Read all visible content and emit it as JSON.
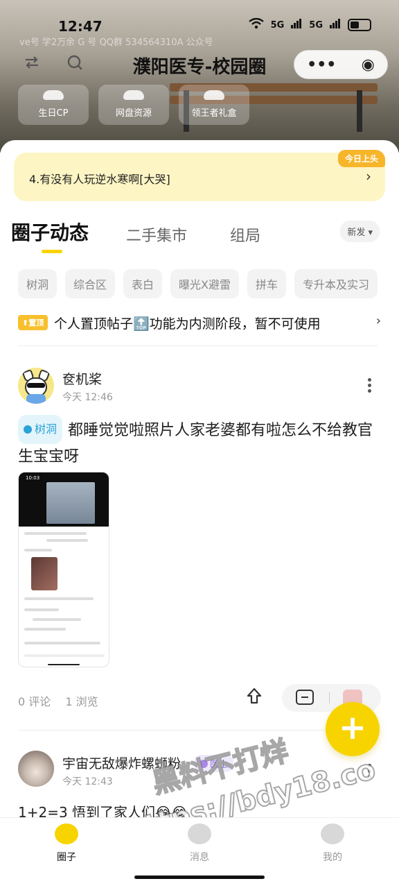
{
  "status_bar": {
    "time": "12:47",
    "signal_1": "5G",
    "signal_2": "5G",
    "ghost_text": "ve号 学2万余 G 号  QQ群  534564310A  公众号"
  },
  "nav": {
    "title": "濮阳医专-校园圈",
    "left_icons": [
      "switch-icon",
      "search-icon"
    ],
    "capsule": {
      "more": "•••",
      "target": "◉"
    }
  },
  "quick_links": [
    {
      "label": "生日CP"
    },
    {
      "label": "网盘资源"
    },
    {
      "label": "领王者礼盒"
    }
  ],
  "notice": {
    "text": "4.有没有人玩逆水寒啊[大哭]",
    "badge": "今日上头",
    "arrow": "›"
  },
  "tabs": {
    "items": [
      "圈子动态",
      "二手集市",
      "组局"
    ],
    "active": 0,
    "sort": "新发 ▾"
  },
  "chips": [
    "树洞",
    "综合区",
    "表白",
    "曝光X避雷",
    "拼车",
    "专升本及实习"
  ],
  "pinned": {
    "badge": "⬆置顶",
    "text": "个人置顶帖子🔝功能为内测阶段，暂不可使用",
    "arrow": "›"
  },
  "posts": [
    {
      "username": "奁机桨",
      "time": "今天 12:46",
      "topic": "树洞",
      "content": "都睡觉觉啦照片人家老婆都有啦怎么不给教官生宝宝呀",
      "stats": {
        "comments": "0 评论",
        "views": "1 浏览"
      },
      "screenshot_time": "10:03"
    },
    {
      "username": "宇宙无敌爆炸螺蛳粉",
      "level": "医士",
      "time": "今天 12:43",
      "content": "1+2=3 悟到了家人们😂😂"
    }
  ],
  "fab": {
    "label": "+"
  },
  "tabbar": {
    "items": [
      "圈子",
      "消息",
      "我的"
    ],
    "active": 0
  },
  "watermark": {
    "line1": "黑料不打烊",
    "line2": "https://bdy18.co"
  },
  "colors": {
    "accent": "#f7d400",
    "notice_bg": "#fdf5c4",
    "topic_blue": "#2aa3d8"
  }
}
